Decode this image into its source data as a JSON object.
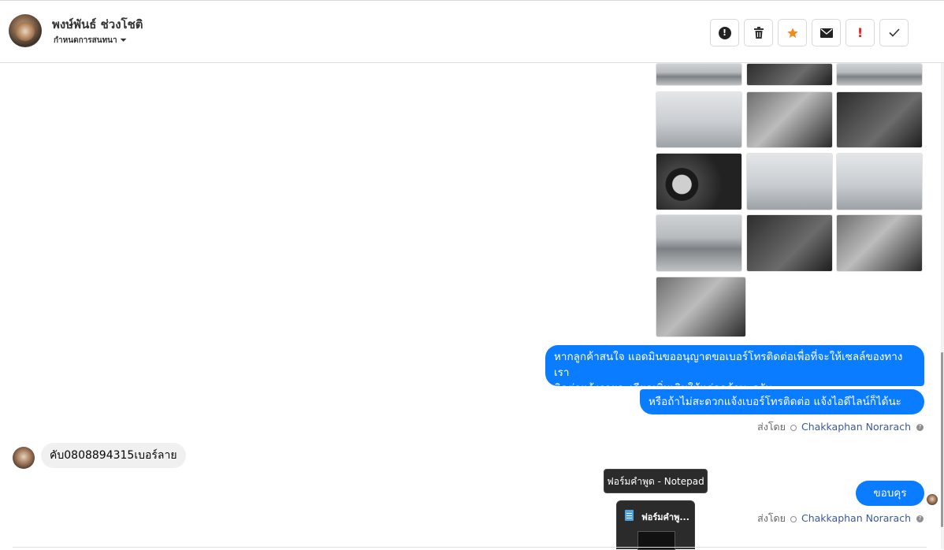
{
  "header": {
    "contact_name": "พงษ์พันธ์ ช่วงโชติ",
    "status_label": "กำหนดการสนทนา",
    "caret": "⏷",
    "actions": [
      {
        "name": "report-spam",
        "icon": "exclamation-circle-icon"
      },
      {
        "name": "delete",
        "icon": "trash-icon"
      },
      {
        "name": "star",
        "icon": "star-icon",
        "color": "#f08a1c"
      },
      {
        "name": "mark-unread",
        "icon": "envelope-icon"
      },
      {
        "name": "important",
        "icon": "exclamation-icon",
        "color": "#e02424"
      },
      {
        "name": "done",
        "icon": "check-icon"
      }
    ]
  },
  "messages": {
    "outgoing_1": "หากลูกค้าสนใจ แอดมินขออนุญาตขอเบอร์โทรติดต่อเพื่อที่จะให้เซลล์ของทางเราติดต่อแจ้งรายละเอียดเพิ่มเติมให้แก่ลูกค้านะครับ",
    "outgoing_1_line1": "หากลูกค้าสนใจ แอดมินขออนุญาตขอเบอร์โทรติดต่อเพื่อที่จะให้เซลล์ของทางเรา",
    "outgoing_1_line2": "ติดต่อแจ้งรายละเอียดเพิ่มเติมให้แก่ลูกค้านะครับ",
    "outgoing_2": "หรือถ้าไม่สะดวกแจ้งเบอร์โทรติดต่อ แจ้งไอดีไลน์ก็ได้นะครับ",
    "sent_by_prefix": "ส่งโดย",
    "agent_name": "Chakkaphan Norarach",
    "help": "?",
    "incoming_1": "คับ0808894315เบอร์ลาย",
    "outgoing_3": "ขอบคุรครับ"
  },
  "taskbar": {
    "tooltip": "ฟอร์มคำพูด - Notepad",
    "preview_title": "ฟอร์มคำพู...",
    "icon": "notepad-icon"
  },
  "accent_color": "#0a7cff"
}
